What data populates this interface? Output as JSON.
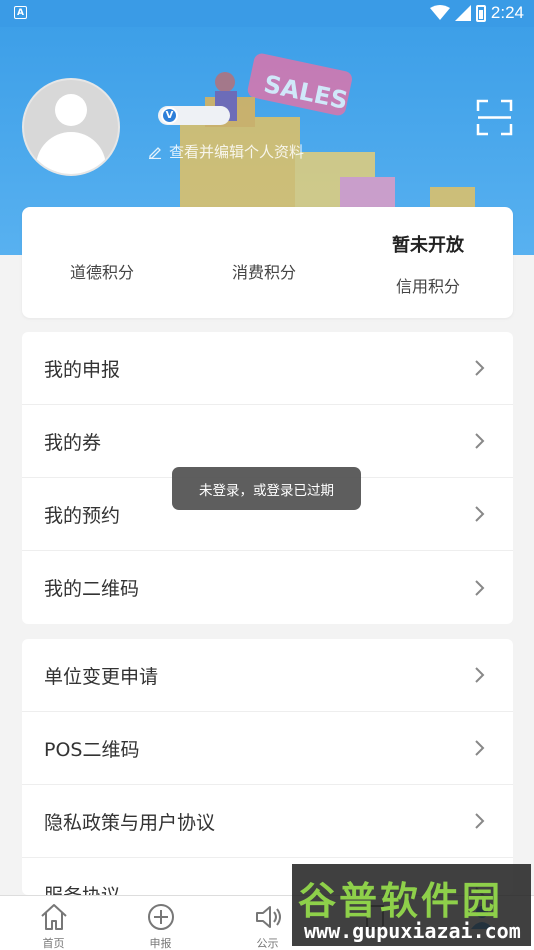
{
  "header": {
    "edit_profile_text": "查看并编辑个人资料",
    "verified_badge": "V"
  },
  "points": {
    "items": [
      {
        "label": "道德积分",
        "value": ""
      },
      {
        "label": "消费积分",
        "value": ""
      },
      {
        "label": "信用积分",
        "value": "暂未开放"
      }
    ]
  },
  "menu_group_1": [
    {
      "label": "我的申报"
    },
    {
      "label": "我的券"
    },
    {
      "label": "我的预约"
    },
    {
      "label": "我的二维码"
    }
  ],
  "menu_group_2": [
    {
      "label": "单位变更申请"
    },
    {
      "label": "POS二维码"
    },
    {
      "label": "隐私政策与用户协议"
    },
    {
      "label": "服务协议"
    }
  ],
  "toast": {
    "message": "未登录，或登录已过期"
  },
  "tabbar": [
    {
      "label": "首页",
      "icon": "home-icon"
    },
    {
      "label": "申报",
      "icon": "plus-circle-icon"
    },
    {
      "label": "公示",
      "icon": "speaker-icon"
    },
    {
      "label": "",
      "icon": "document-icon"
    },
    {
      "label": "",
      "icon": "profile-icon"
    }
  ],
  "status_bar": {
    "time": "2:24",
    "app_letter": "A"
  },
  "watermark": {
    "brand": "谷普软件园",
    "url": "www.gupuxiazai.com"
  },
  "colors": {
    "header_blue": "#3d9fe8",
    "toast_bg": "#505050"
  }
}
